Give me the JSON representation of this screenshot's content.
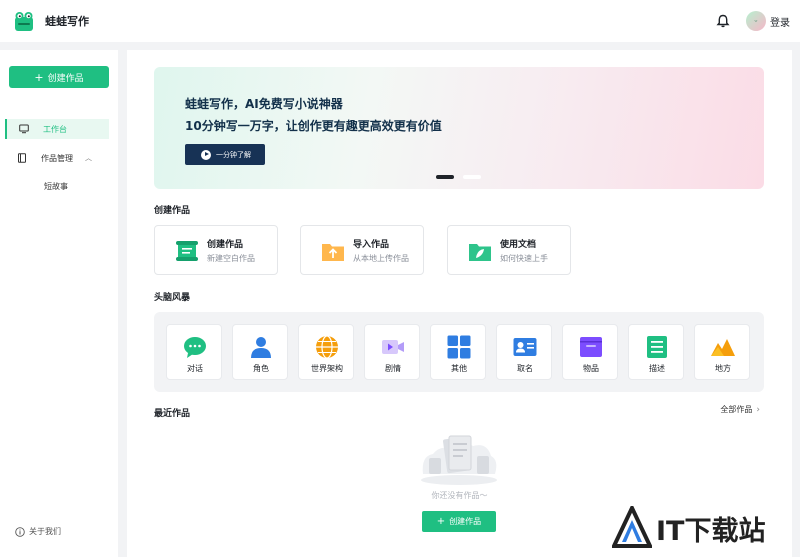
{
  "app": {
    "brand": "蛙蛙写作"
  },
  "header": {
    "login_label": "登录",
    "avatar_glyph": "ᵕ"
  },
  "sidebar": {
    "create_label": "创建作品",
    "items": [
      {
        "label": "工作台",
        "icon": "monitor-icon",
        "active": true
      },
      {
        "label": "作品管理",
        "icon": "book-icon",
        "expanded": true
      }
    ],
    "sub_items": [
      {
        "label": "短故事"
      }
    ],
    "about_label": "关于我们"
  },
  "banner": {
    "title": "蛙蛙写作，AI免费写小说神器",
    "subtitle": "10分钟写一万字，让创作更有趣更高效更有价值",
    "cta_label": "一分钟了解",
    "slide_count": 2,
    "active_slide": 0
  },
  "create_section": {
    "title": "创建作品",
    "cards": [
      {
        "title": "创建作品",
        "desc": "新建空白作品",
        "icon": "scroll-icon"
      },
      {
        "title": "导入作品",
        "desc": "从本地上传作品",
        "icon": "upload-folder-icon"
      },
      {
        "title": "使用文档",
        "desc": "如何快速上手",
        "icon": "leaf-folder-icon"
      }
    ]
  },
  "brainstorm": {
    "title": "头脑风暴",
    "tiles": [
      {
        "label": "对话",
        "icon": "chat-bubble-icon"
      },
      {
        "label": "角色",
        "icon": "person-icon"
      },
      {
        "label": "世界架构",
        "icon": "globe-icon"
      },
      {
        "label": "剧情",
        "icon": "video-camera-icon"
      },
      {
        "label": "其他",
        "icon": "grid-icon"
      },
      {
        "label": "取名",
        "icon": "id-card-icon"
      },
      {
        "label": "物品",
        "icon": "box-icon"
      },
      {
        "label": "描述",
        "icon": "document-list-icon"
      },
      {
        "label": "地方",
        "icon": "mountain-icon"
      }
    ]
  },
  "recent": {
    "title": "最近作品",
    "view_all_label": "全部作品",
    "empty_text": "你还没有作品～",
    "create_label": "创建作品"
  },
  "watermark": {
    "text": "IT下载站"
  },
  "colors": {
    "accent": "#1fbf82",
    "navy": "#173255"
  }
}
